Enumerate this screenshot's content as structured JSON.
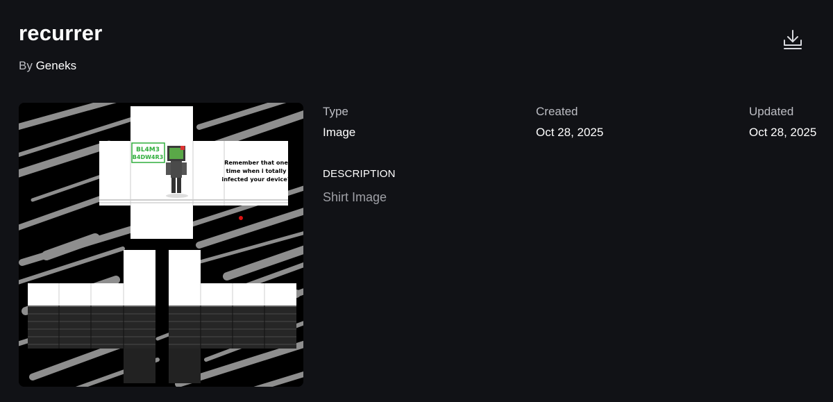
{
  "asset": {
    "title": "recurrer",
    "by_prefix": "By",
    "creator": "Geneks"
  },
  "actions": {
    "download_icon": "download-icon"
  },
  "details": {
    "type_label": "Type",
    "type_value": "Image",
    "created_label": "Created",
    "created_value": "Oct 28, 2025",
    "updated_label": "Updated",
    "updated_value": "Oct 28, 2025"
  },
  "description": {
    "heading": "DESCRIPTION",
    "text": "Shirt Image"
  },
  "thumbnail": {
    "sign_text_line1": "BL4M3",
    "sign_text_line2": "B4DW4R3",
    "caption_line1": "Remember that one",
    "caption_line2": "time when i totally",
    "caption_line3": "infected your device?"
  },
  "colors": {
    "background": "#111216",
    "text_primary": "#ffffff",
    "text_secondary": "#bdbec4",
    "sign_green": "#2fae3c"
  }
}
